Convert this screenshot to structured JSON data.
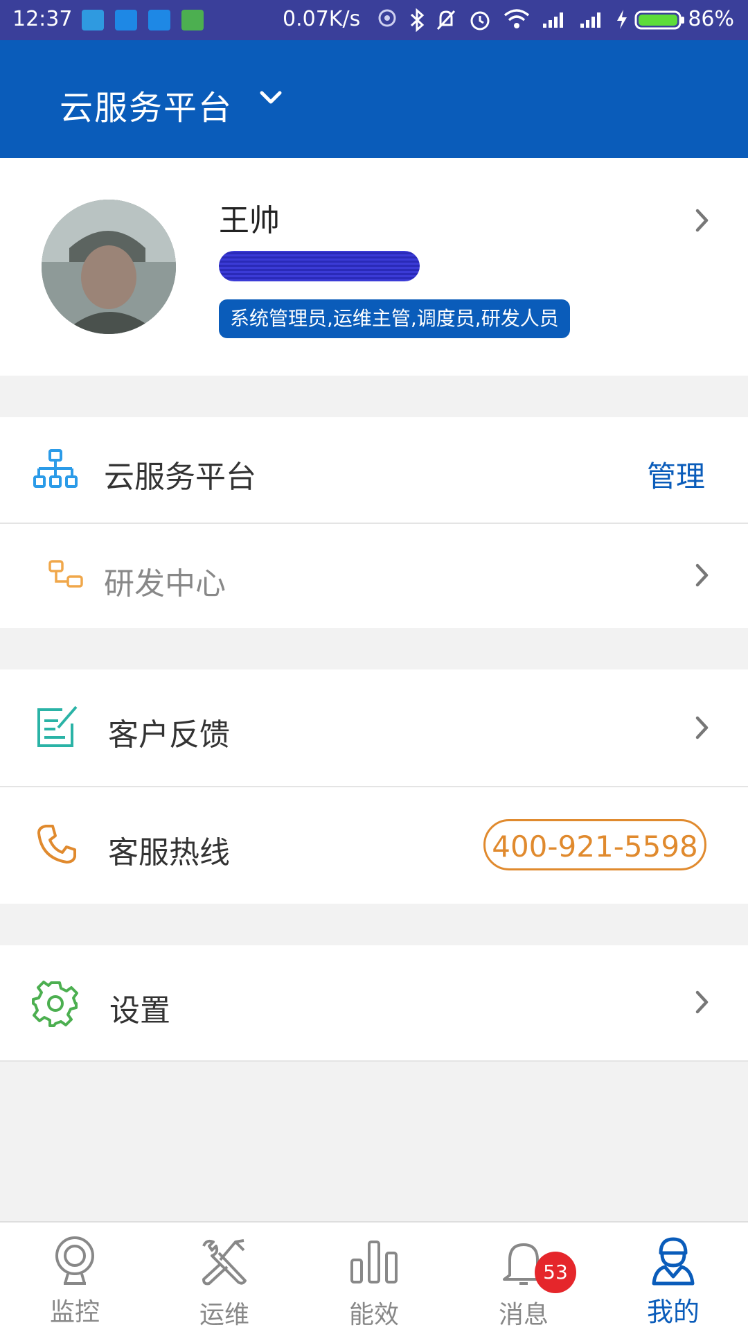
{
  "status_bar": {
    "time": "12:37",
    "network_speed": "0.07K/s",
    "battery_percent": "86%",
    "battery_level": 0.86
  },
  "header": {
    "title": "云服务平台"
  },
  "profile": {
    "name": "王帅",
    "roles": "系统管理员,运维主管,调度员,研发人员"
  },
  "org": {
    "platform_label": "云服务平台",
    "manage_label": "管理",
    "center_label": "研发中心"
  },
  "menu": {
    "feedback_label": "客户反馈",
    "hotline_label": "客服热线",
    "hotline_number": "400-921-5598",
    "settings_label": "设置"
  },
  "tabbar": {
    "tabs": [
      {
        "label": "监控",
        "icon": "camera-icon"
      },
      {
        "label": "运维",
        "icon": "tools-icon"
      },
      {
        "label": "能效",
        "icon": "bar-chart-icon"
      },
      {
        "label": "消息",
        "icon": "bell-icon"
      },
      {
        "label": "我的",
        "icon": "user-icon"
      }
    ],
    "active_index": 4,
    "message_badge": "53"
  },
  "colors": {
    "status_bar": "#3a3f9a",
    "primary": "#0a5cba",
    "hotline": "#e08a2e",
    "badge": "#e5262b",
    "settings_icon": "#4caf50",
    "feedback_icon": "#2ab3a6"
  }
}
